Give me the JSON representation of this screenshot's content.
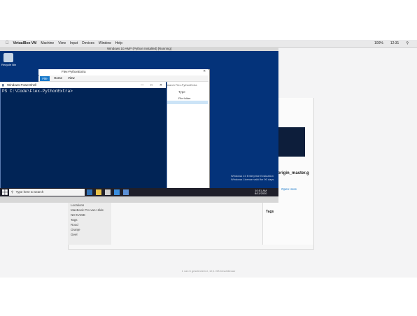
{
  "menubar": {
    "app": "VirtualBox VM",
    "items": [
      "Machine",
      "View",
      "Input",
      "Devices",
      "Window",
      "Help"
    ],
    "clock": "12:31",
    "battery": "100%"
  },
  "vm": {
    "title": "Windows 10 AMP (Python Installed) [Running]"
  },
  "desktop": {
    "recycle_label": "Recycle Bin"
  },
  "explorer": {
    "title": "Flex-PythonExtra",
    "tab_file": "File",
    "tab_home": "Home",
    "tab_view": "View",
    "search_placeholder": "Search Flex-PythonExtra",
    "col_type": "Type",
    "row_type": "File folder"
  },
  "powershell": {
    "title": "Windows PowerShell",
    "prompt": "PS C:\\Code\\Flex-PythonExtra>"
  },
  "taskbar": {
    "search_placeholder": "Type here to search",
    "time": "10:51 AM",
    "date": "8/11/2020"
  },
  "watermark": {
    "line1": "Windows 10 Enterprise Evaluation",
    "line2": "Windows License valid for 90 days"
  },
  "host": {
    "filename": "origin_master.g",
    "panel_open": "Open Here",
    "tags_heading": "Tags",
    "sidebar": [
      "Locations",
      "MacBook Pro van Hilde",
      "NO NAME",
      "Tags",
      "Rood",
      "Oranje",
      "Geel"
    ]
  },
  "footer": "1 van 6 geselecteerd, 12,1 GB beschikbaar",
  "colors": {
    "ps_bg": "#012456",
    "desktop_bg": "#04337a",
    "accent": "#1979ca"
  }
}
